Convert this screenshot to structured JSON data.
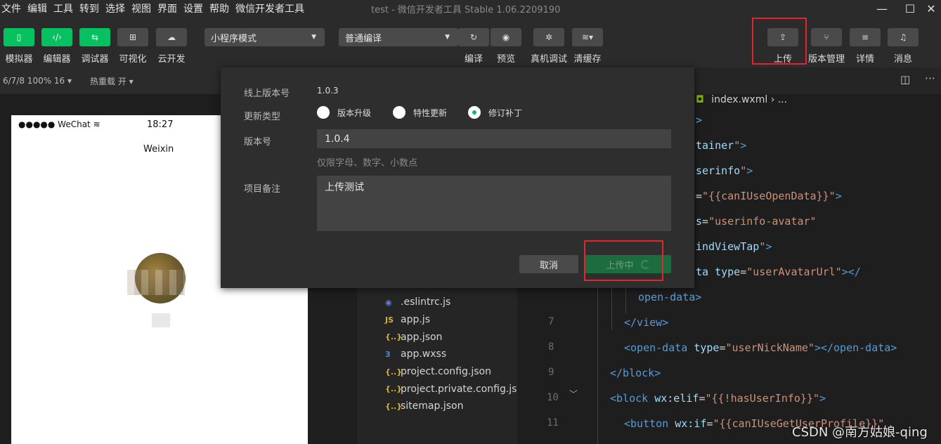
{
  "menu": [
    "文件",
    "编辑",
    "工具",
    "转到",
    "选择",
    "视图",
    "界面",
    "设置",
    "帮助",
    "微信开发者工具"
  ],
  "window_title": "test - 微信开发者工具 Stable 1.06.2209190",
  "window_controls": {
    "minimize": "—",
    "maximize": "☐",
    "close": "✕"
  },
  "toolbar": {
    "left_tools": [
      {
        "label": "模拟器",
        "icon": "phone-icon",
        "glyph": "▯"
      },
      {
        "label": "编辑器",
        "icon": "code-icon",
        "glyph": "‹/›"
      },
      {
        "label": "调试器",
        "icon": "debug-icon",
        "glyph": "⇆"
      },
      {
        "label": "可视化",
        "icon": "layout-icon",
        "glyph": "⊞"
      },
      {
        "label": "云开发",
        "icon": "cloud-icon",
        "glyph": "☁"
      }
    ],
    "mode_select": "小程序模式",
    "compile_select": "普通编译",
    "mid_tools": [
      {
        "label": "编译",
        "icon": "refresh-icon",
        "glyph": "↻"
      },
      {
        "label": "预览",
        "icon": "eye-icon",
        "glyph": "◉"
      },
      {
        "label": "真机调试",
        "icon": "bug-icon",
        "glyph": "✲"
      },
      {
        "label": "清缓存",
        "icon": "layers-icon",
        "glyph": "≋▾"
      }
    ],
    "right_tools": [
      {
        "label": "上传",
        "icon": "upload-icon",
        "glyph": "⇪"
      },
      {
        "label": "版本管理",
        "icon": "branch-icon",
        "glyph": "⑂"
      },
      {
        "label": "详情",
        "icon": "menu-icon",
        "glyph": "≡"
      },
      {
        "label": "消息",
        "icon": "bell-icon",
        "glyph": "♫"
      }
    ]
  },
  "simbar": {
    "device": "6/7/8 100% 16 ▾",
    "hot_reload": "热重载 开 ▾"
  },
  "phone": {
    "status": "●●●●● WeChat",
    "wifi": "wifi-icon",
    "time": "18:27",
    "nav_title": "Weixin"
  },
  "modal": {
    "online_version_label": "线上版本号",
    "online_version_value": "1.0.3",
    "update_type_label": "更新类型",
    "update_types": [
      "版本升级",
      "特性更新",
      "修订补丁"
    ],
    "selected_update_type": "修订补丁",
    "version_label": "版本号",
    "version_value": "1.0.4",
    "version_hint": "仅限字母、数字、小数点",
    "notes_label": "项目备注",
    "notes_value": "上传测试",
    "cancel_label": "取消",
    "upload_label": "上传中"
  },
  "breadcrumb": {
    "file": "index.wxml",
    "rest": "› ..."
  },
  "files": [
    {
      "name": ".eslintrc.js",
      "icon": "eslint-icon",
      "glyph": "◉",
      "color": "#6b79d8"
    },
    {
      "name": "app.js",
      "icon": "js-icon",
      "glyph": "JS",
      "color": "#d8b12c"
    },
    {
      "name": "app.json",
      "icon": "json-icon",
      "glyph": "{..}",
      "color": "#d8b12c"
    },
    {
      "name": "app.wxss",
      "icon": "css-icon",
      "glyph": "3",
      "color": "#4f8bd8"
    },
    {
      "name": "project.config.json",
      "icon": "json-icon",
      "glyph": "{..}",
      "color": "#d8b12c"
    },
    {
      "name": "project.private.config.js...",
      "icon": "json-icon",
      "glyph": "{..}",
      "color": "#d8b12c"
    },
    {
      "name": "sitemap.json",
      "icon": "json-icon",
      "glyph": "{..}",
      "color": "#d8b12c"
    }
  ],
  "line_numbers": [
    "7",
    "8",
    "9",
    "10",
    "11"
  ],
  "code_lines": [
    [
      {
        "c": "t",
        "v": ">"
      }
    ],
    [
      {
        "c": "a",
        "v": "tainer"
      },
      {
        "c": "s",
        "v": "\""
      },
      {
        "c": "t",
        "v": ">"
      }
    ],
    [
      {
        "c": "a",
        "v": "serinfo"
      },
      {
        "c": "s",
        "v": "\""
      },
      {
        "c": "t",
        "v": ">"
      }
    ],
    [
      {
        "c": "p",
        "v": "="
      },
      {
        "c": "s",
        "v": "\"{{canIUseOpenData}}\""
      },
      {
        "c": "t",
        "v": ">"
      }
    ],
    [
      {
        "c": "a",
        "v": "s"
      },
      {
        "c": "p",
        "v": "="
      },
      {
        "c": "s",
        "v": "\"userinfo-avatar\""
      }
    ],
    [
      {
        "c": "a",
        "v": "indViewTap"
      },
      {
        "c": "s",
        "v": "\""
      },
      {
        "c": "t",
        "v": ">"
      }
    ],
    [
      {
        "c": "a",
        "v": "ta "
      },
      {
        "c": "a",
        "v": "type"
      },
      {
        "c": "p",
        "v": "="
      },
      {
        "c": "s",
        "v": "\"userAvatarUrl\""
      },
      {
        "c": "t",
        "v": "></"
      }
    ],
    [
      {
        "c": "t",
        "v": "open-data>"
      }
    ],
    [
      {
        "c": "t",
        "v": "</view>"
      }
    ],
    [
      {
        "c": "t",
        "v": "<open-data "
      },
      {
        "c": "a",
        "v": "type"
      },
      {
        "c": "p",
        "v": "="
      },
      {
        "c": "s",
        "v": "\"userNickName\""
      },
      {
        "c": "t",
        "v": "></open-data>"
      }
    ],
    [
      {
        "c": "t",
        "v": "</block>"
      }
    ],
    [
      {
        "c": "t",
        "v": "<block "
      },
      {
        "c": "a",
        "v": "wx:elif"
      },
      {
        "c": "p",
        "v": "="
      },
      {
        "c": "s",
        "v": "\"{{!hasUserInfo}}\""
      },
      {
        "c": "t",
        "v": ">"
      }
    ],
    [
      {
        "c": "t",
        "v": "<button "
      },
      {
        "c": "a",
        "v": "wx:if"
      },
      {
        "c": "p",
        "v": "="
      },
      {
        "c": "s",
        "v": "\"{{canIUseGetUserProfile}}\""
      }
    ]
  ],
  "watermark": "CSDN @南方姑娘-qing",
  "colors": {
    "accent": "#07c160",
    "highlight_box": "#e0262a",
    "tag": "#569cd6",
    "attr": "#9cdcfe",
    "string": "#ce9178"
  }
}
